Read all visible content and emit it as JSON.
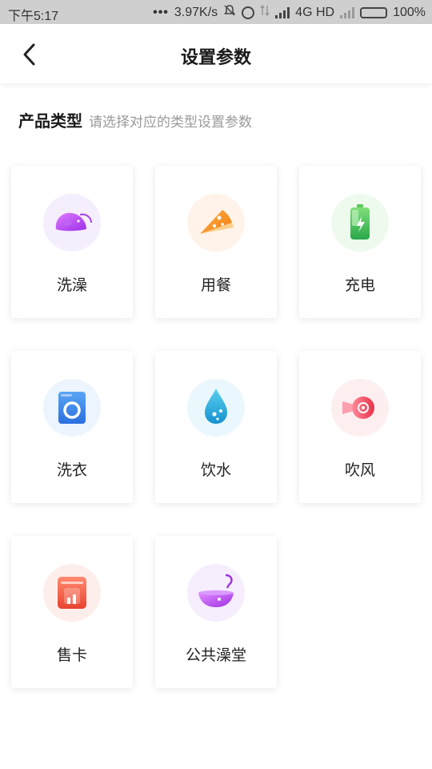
{
  "status_bar": {
    "time": "下午5:17",
    "dots": "•••",
    "speed": "3.97K/s",
    "network": "4G HD",
    "battery": "100%"
  },
  "header": {
    "title": "设置参数"
  },
  "section": {
    "heading": "产品类型",
    "hint": "请选择对应的类型设置参数"
  },
  "products": [
    {
      "label": "洗澡",
      "icon": "bath-slipper-icon",
      "color": "#b04cf0"
    },
    {
      "label": "用餐",
      "icon": "pizza-slice-icon",
      "color": "#f7931e"
    },
    {
      "label": "充电",
      "icon": "battery-charge-icon",
      "color": "#3dbb4f"
    },
    {
      "label": "洗衣",
      "icon": "washing-machine-icon",
      "color": "#2f7fe8"
    },
    {
      "label": "饮水",
      "icon": "water-drop-icon",
      "color": "#1aa0d8"
    },
    {
      "label": "吹风",
      "icon": "hair-dryer-icon",
      "color": "#f0485b"
    },
    {
      "label": "售卡",
      "icon": "card-sale-icon",
      "color": "#ee5540"
    },
    {
      "label": "公共澡堂",
      "icon": "public-bathtub-icon",
      "color": "#b24ce0"
    }
  ]
}
